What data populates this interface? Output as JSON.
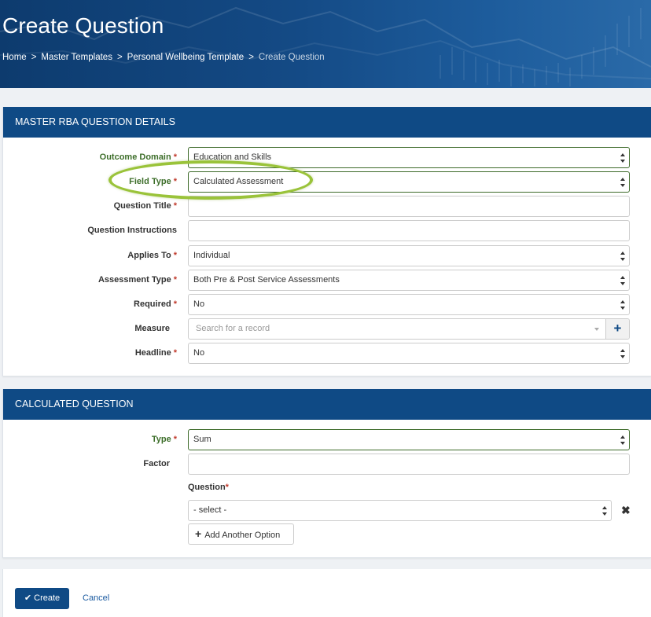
{
  "header": {
    "title": "Create Question",
    "breadcrumbs": [
      "Home",
      "Master Templates",
      "Personal Wellbeing Template",
      "Create Question"
    ],
    "separator": ">"
  },
  "details": {
    "heading": "MASTER RBA QUESTION DETAILS",
    "outcome_domain": {
      "label": "Outcome Domain",
      "value": "Education and Skills"
    },
    "field_type": {
      "label": "Field Type",
      "value": "Calculated Assessment"
    },
    "question_title": {
      "label": "Question Title",
      "value": ""
    },
    "question_instructions": {
      "label": "Question Instructions",
      "value": ""
    },
    "applies_to": {
      "label": "Applies To",
      "value": "Individual"
    },
    "assessment_type": {
      "label": "Assessment Type",
      "value": "Both Pre & Post Service Assessments"
    },
    "required": {
      "label": "Required",
      "value": "No"
    },
    "measure": {
      "label": "Measure",
      "placeholder": "Search for a record",
      "add_icon": "plus-icon"
    },
    "headline": {
      "label": "Headline",
      "value": "No"
    },
    "required_mark": "*"
  },
  "calculated": {
    "heading": "CALCULATED QUESTION",
    "type": {
      "label": "Type",
      "value": "Sum"
    },
    "factor": {
      "label": "Factor",
      "value": ""
    },
    "question": {
      "label": "Question",
      "value": "- select -"
    },
    "remove_icon": "✖",
    "add_option_label": "Add Another Option",
    "add_icon": "+"
  },
  "actions": {
    "create_label": "Create",
    "create_icon": "✔",
    "cancel_label": "Cancel"
  },
  "colors": {
    "header_blue": "#0f4a85",
    "label_green": "#3d6e2a",
    "highlight_green": "#9ac33a",
    "required_red": "#c0392b"
  }
}
